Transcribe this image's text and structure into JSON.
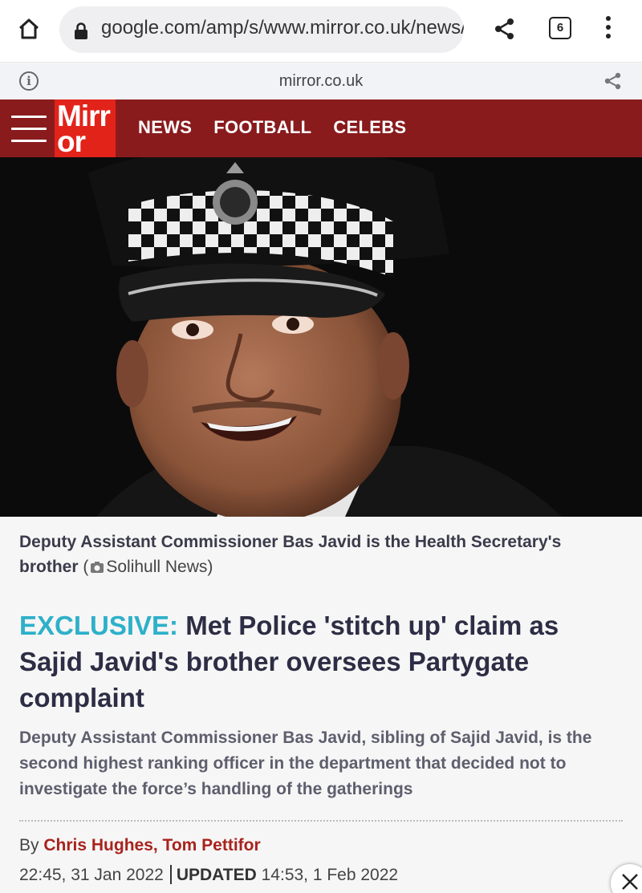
{
  "browser": {
    "url": "google.com/amp/s/www.mirror.co.uk/news/",
    "tab_count": "6",
    "amp_domain": "mirror.co.uk"
  },
  "site": {
    "logo_line1": "Mirr",
    "logo_line2": "or",
    "nav": [
      "NEWS",
      "FOOTBALL",
      "CELEBS"
    ],
    "brand_color": "#891b1d",
    "logo_color": "#e2231a"
  },
  "article": {
    "caption": "Deputy Assistant Commissioner Bas Javid is the Health Secretary's brother",
    "caption_credit_open": "(",
    "caption_credit": "Solihull News)",
    "headline_tag": "EXCLUSIVE:",
    "headline": "Met Police 'stitch up' claim as Sajid Javid's brother oversees Partygate complaint",
    "standfirst": "Deputy Assistant Commissioner Bas Javid, sibling of Sajid Javid, is the second highest ranking officer in the department that decided not to investigate the force’s handling of the gatherings",
    "byline_prefix": "By",
    "authors": "Chris Hughes, Tom Pettifor",
    "published": "22:45, 31 Jan 2022",
    "updated_label": "UPDATED",
    "updated": "14:53, 1 Feb 2022",
    "accent_color": "#2eb0c9"
  },
  "icons": {
    "home": "home-icon",
    "lock": "lock-icon",
    "share": "share-icon",
    "menu": "more-vert-icon",
    "info": "info-icon",
    "camera": "camera-icon",
    "close": "close-icon",
    "hamburger": "hamburger-icon"
  }
}
